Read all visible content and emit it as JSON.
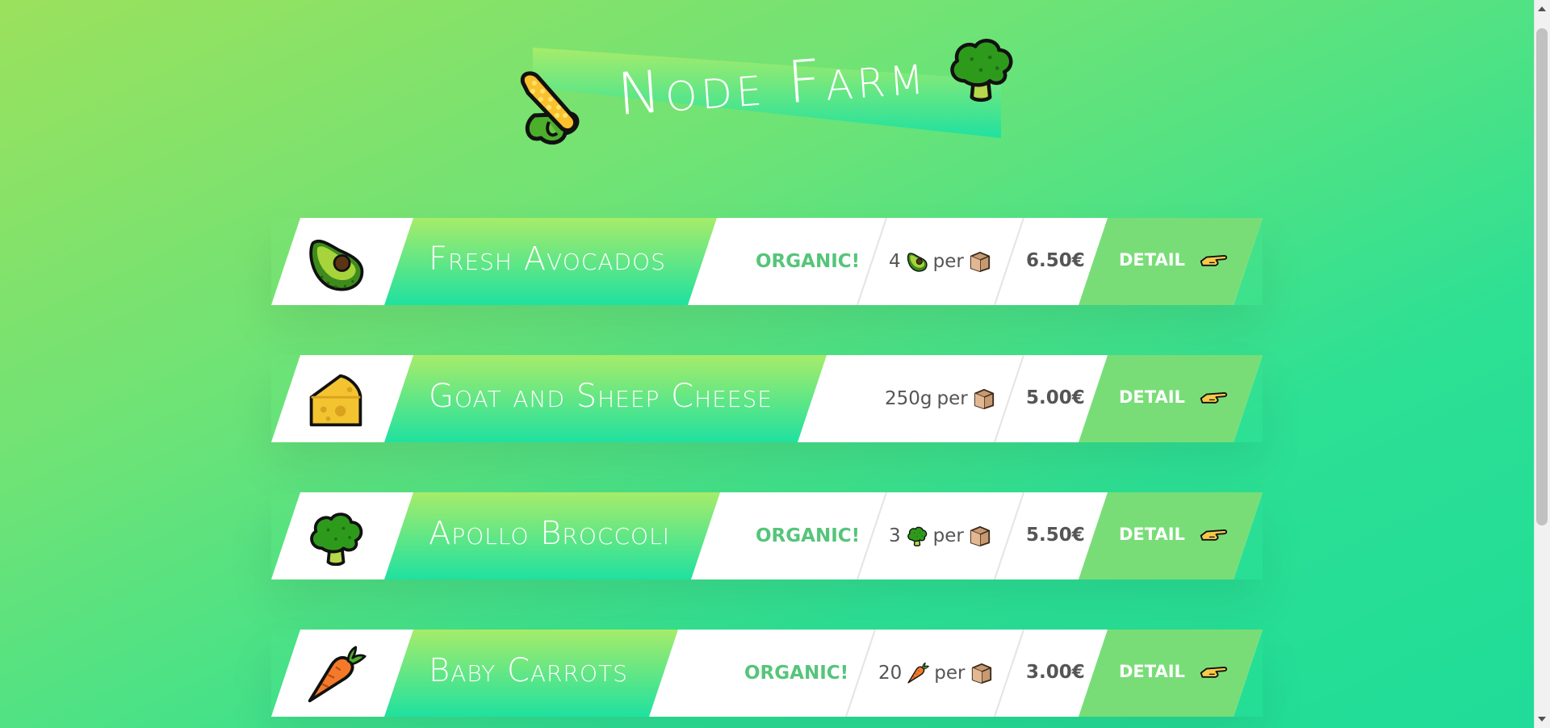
{
  "header": {
    "title": "Node Farm",
    "left_icon": "corn-icon",
    "right_icon": "broccoli-icon"
  },
  "colors": {
    "bg_gradient_start": "#9be15d",
    "bg_gradient_end": "#1fdc98",
    "organic": "#55c57a",
    "card_detail_bg": "#79dd77"
  },
  "products": [
    {
      "icon": "avocado-icon",
      "name": "Fresh Avocados",
      "organic_label": "ORGANIC!",
      "quantity_prefix": "4",
      "quantity_icon": "avocado-icon",
      "per_label": "per",
      "box_icon": "box-icon",
      "price": "6.50€",
      "detail_label": "DETAIL"
    },
    {
      "icon": "cheese-icon",
      "name": "Goat and Sheep Cheese",
      "organic_label": "",
      "quantity_prefix": "250g",
      "quantity_icon": "",
      "per_label": "per",
      "box_icon": "box-icon",
      "price": "5.00€",
      "detail_label": "DETAIL"
    },
    {
      "icon": "broccoli-icon",
      "name": "Apollo Broccoli",
      "organic_label": "ORGANIC!",
      "quantity_prefix": "3",
      "quantity_icon": "broccoli-icon",
      "per_label": "per",
      "box_icon": "box-icon",
      "price": "5.50€",
      "detail_label": "DETAIL"
    },
    {
      "icon": "carrot-icon",
      "name": "Baby Carrots",
      "organic_label": "ORGANIC!",
      "quantity_prefix": "20",
      "quantity_icon": "carrot-icon",
      "per_label": "per",
      "box_icon": "box-icon",
      "price": "3.00€",
      "detail_label": "DETAIL"
    }
  ]
}
